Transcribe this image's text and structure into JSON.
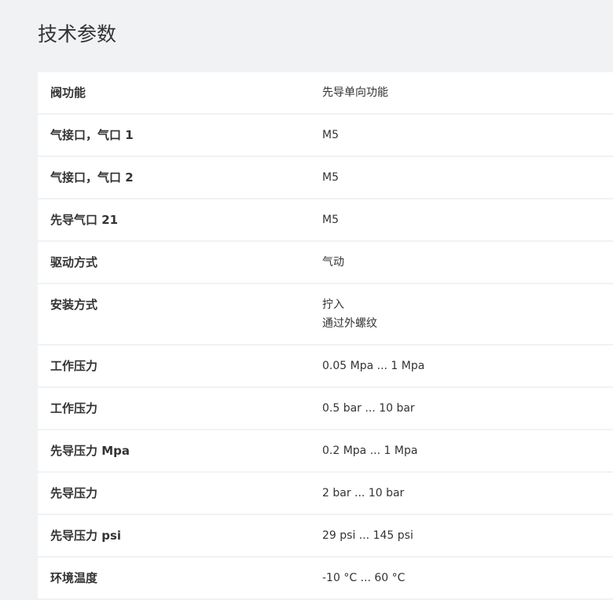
{
  "page": {
    "title": "技术参数"
  },
  "specs": [
    {
      "label": "阀功能",
      "values": [
        "先导单向功能"
      ]
    },
    {
      "label": "气接口，气口 1",
      "values": [
        "M5"
      ]
    },
    {
      "label": "气接口，气口 2",
      "values": [
        "M5"
      ]
    },
    {
      "label": "先导气口 21",
      "values": [
        "M5"
      ]
    },
    {
      "label": "驱动方式",
      "values": [
        "气动"
      ]
    },
    {
      "label": "安装方式",
      "values": [
        "拧入",
        "通过外螺纹"
      ]
    },
    {
      "label": "工作压力",
      "values": [
        "0.05 Mpa ... 1 Mpa"
      ]
    },
    {
      "label": "工作压力",
      "values": [
        "0.5 bar ... 10 bar"
      ]
    },
    {
      "label": "先导压力 Mpa",
      "values": [
        "0.2 Mpa ... 1 Mpa"
      ]
    },
    {
      "label": "先导压力",
      "values": [
        "2 bar ... 10 bar"
      ]
    },
    {
      "label": "先导压力 psi",
      "values": [
        "29 psi ... 145 psi"
      ]
    },
    {
      "label": "环境温度",
      "values": [
        "-10 °C ... 60 °C"
      ]
    }
  ]
}
